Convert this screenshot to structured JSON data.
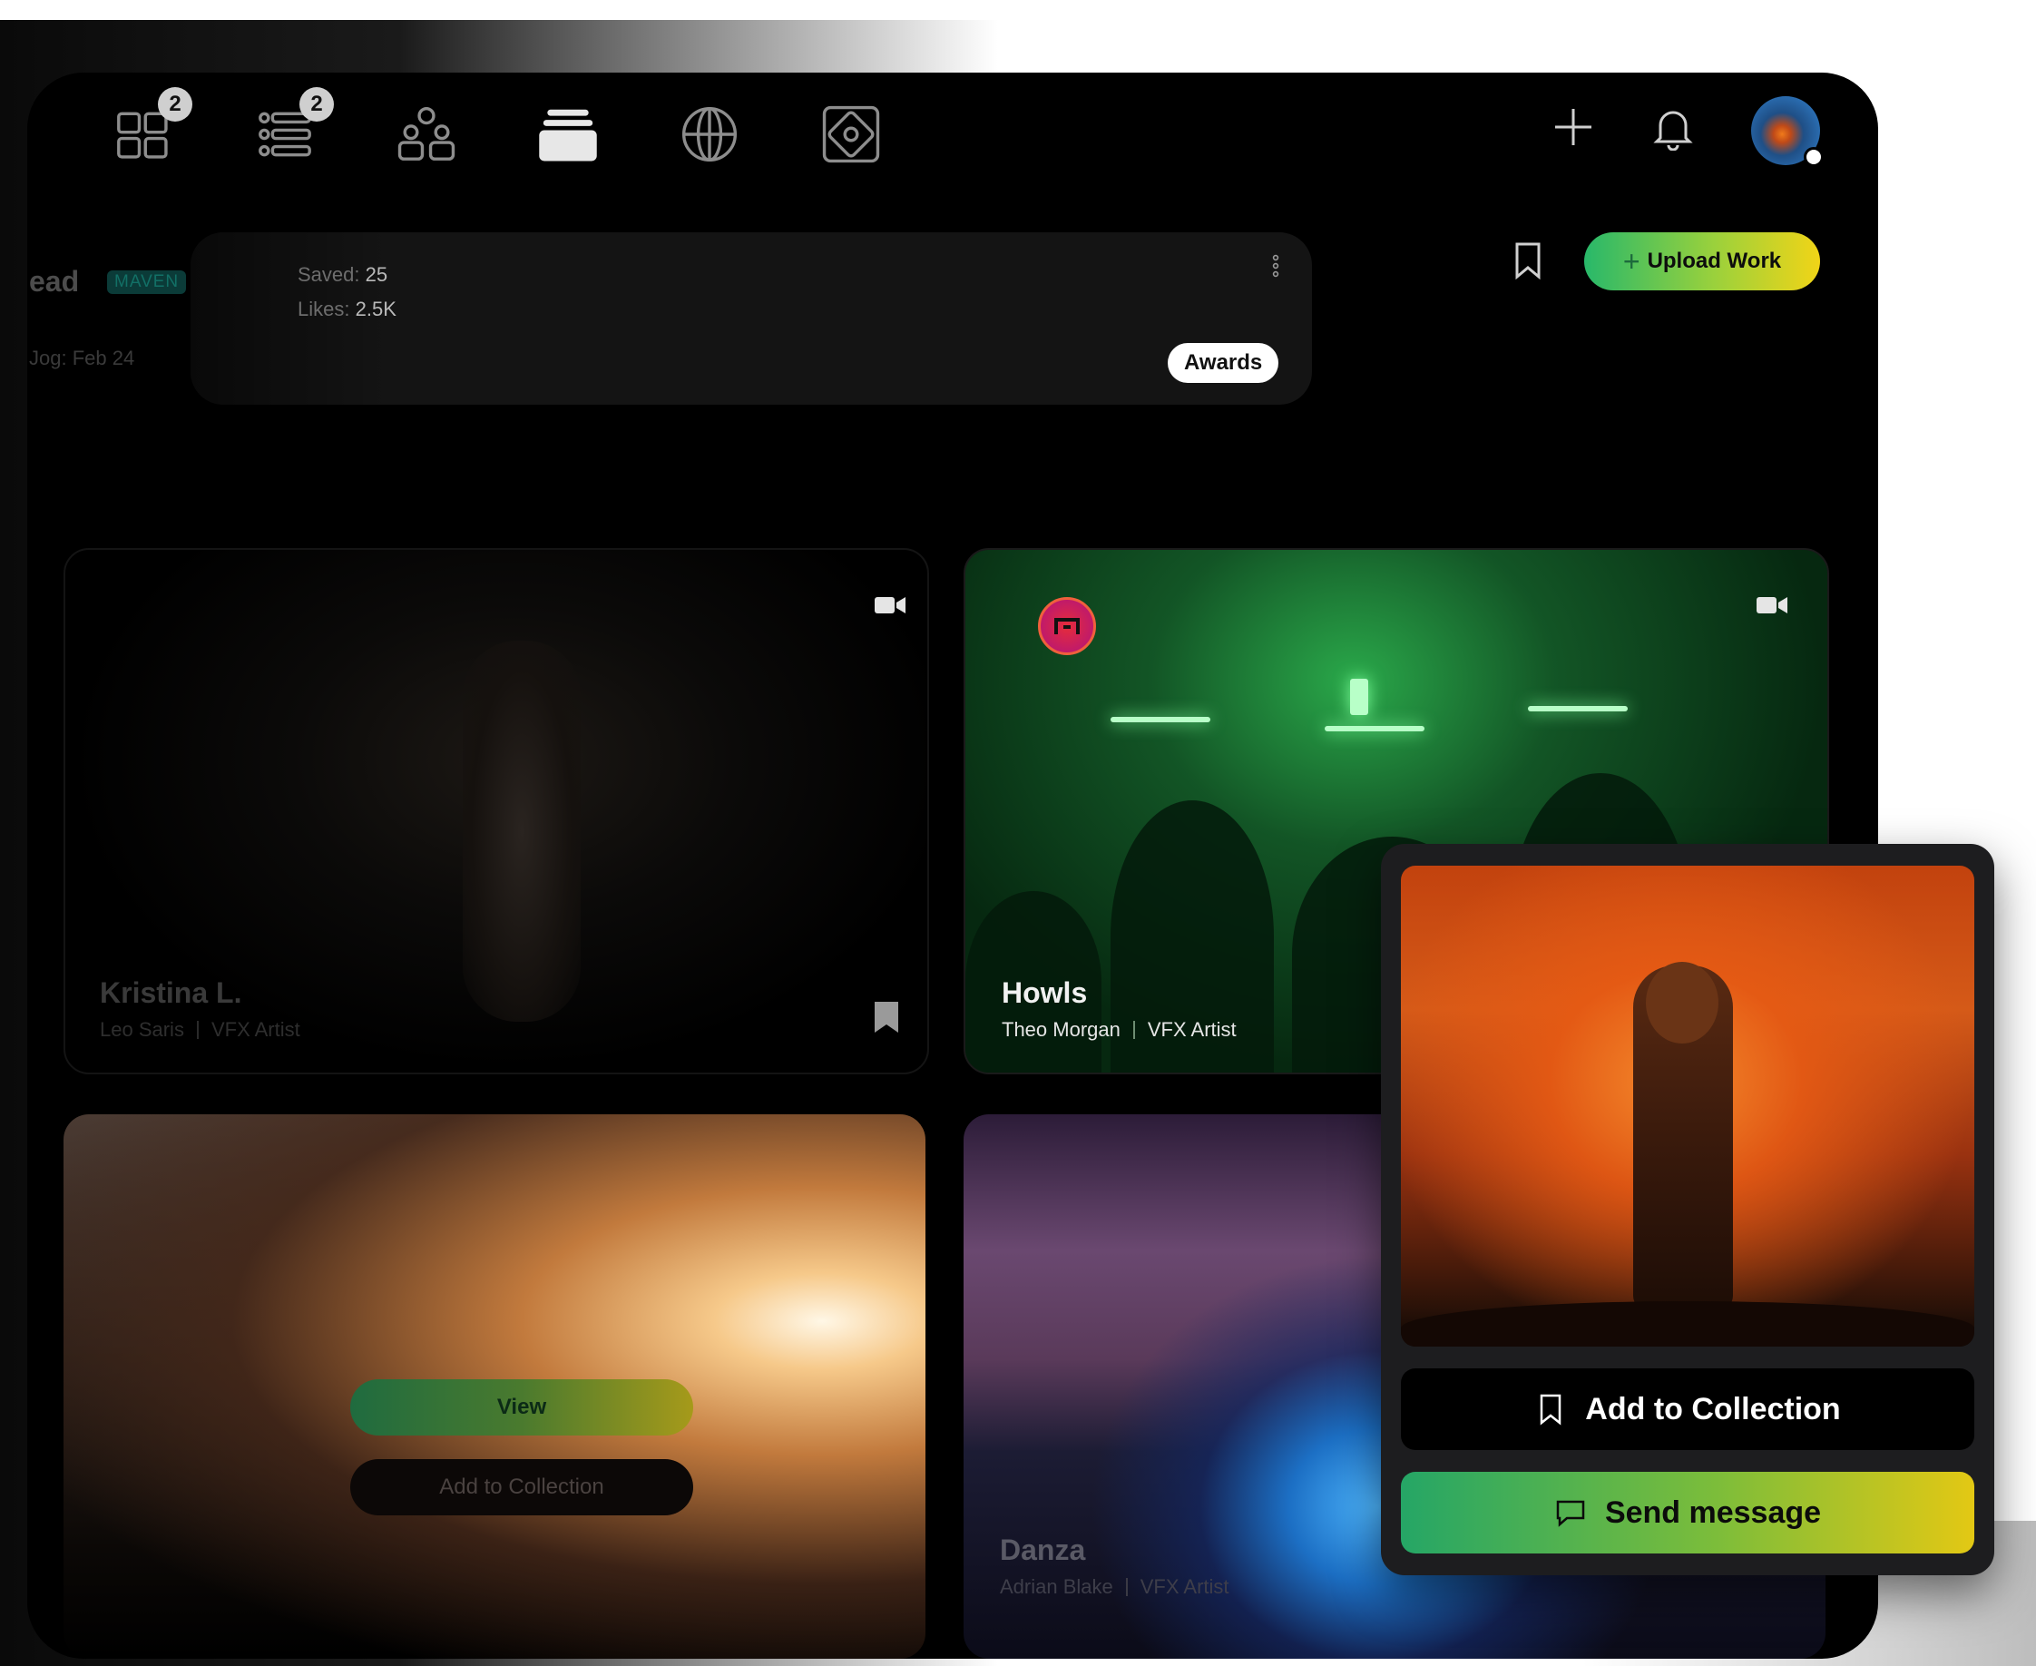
{
  "nav": {
    "items": [
      {
        "name": "dashboard-icon",
        "badge": "2"
      },
      {
        "name": "list-icon",
        "badge": "2"
      },
      {
        "name": "community-icon",
        "badge": ""
      },
      {
        "name": "stack-icon",
        "badge": ""
      },
      {
        "name": "globe-icon",
        "badge": ""
      },
      {
        "name": "gallery-icon",
        "badge": ""
      }
    ],
    "right": [
      "plus-icon",
      "bell-icon",
      "avatar"
    ]
  },
  "profile": {
    "name_fragment": "ead",
    "tier": "MAVEN",
    "joined": "Jog: Feb 24",
    "saved_label": "Saved:",
    "saved_value": "25",
    "likes_label": "Likes:",
    "likes_value": "2.5K",
    "awards": "Awards"
  },
  "actions": {
    "upload": "Upload Work"
  },
  "cards": [
    {
      "title": "Kristina L.",
      "author": "Leo Saris",
      "role": "VFX Artist"
    },
    {
      "title": "Howls",
      "author": "Theo Morgan",
      "role": "VFX Artist"
    },
    {
      "title": "",
      "author": "",
      "role": "",
      "view": "View",
      "add": "Add to Collection"
    },
    {
      "title": "Danza",
      "author": "Adrian Blake",
      "role": "VFX Artist"
    }
  ],
  "popup": {
    "add": "Add to Collection",
    "send": "Send message"
  },
  "colors": {
    "accent_green": "#28b86a",
    "accent_yellow": "#f1d417",
    "frame": "#000000"
  }
}
